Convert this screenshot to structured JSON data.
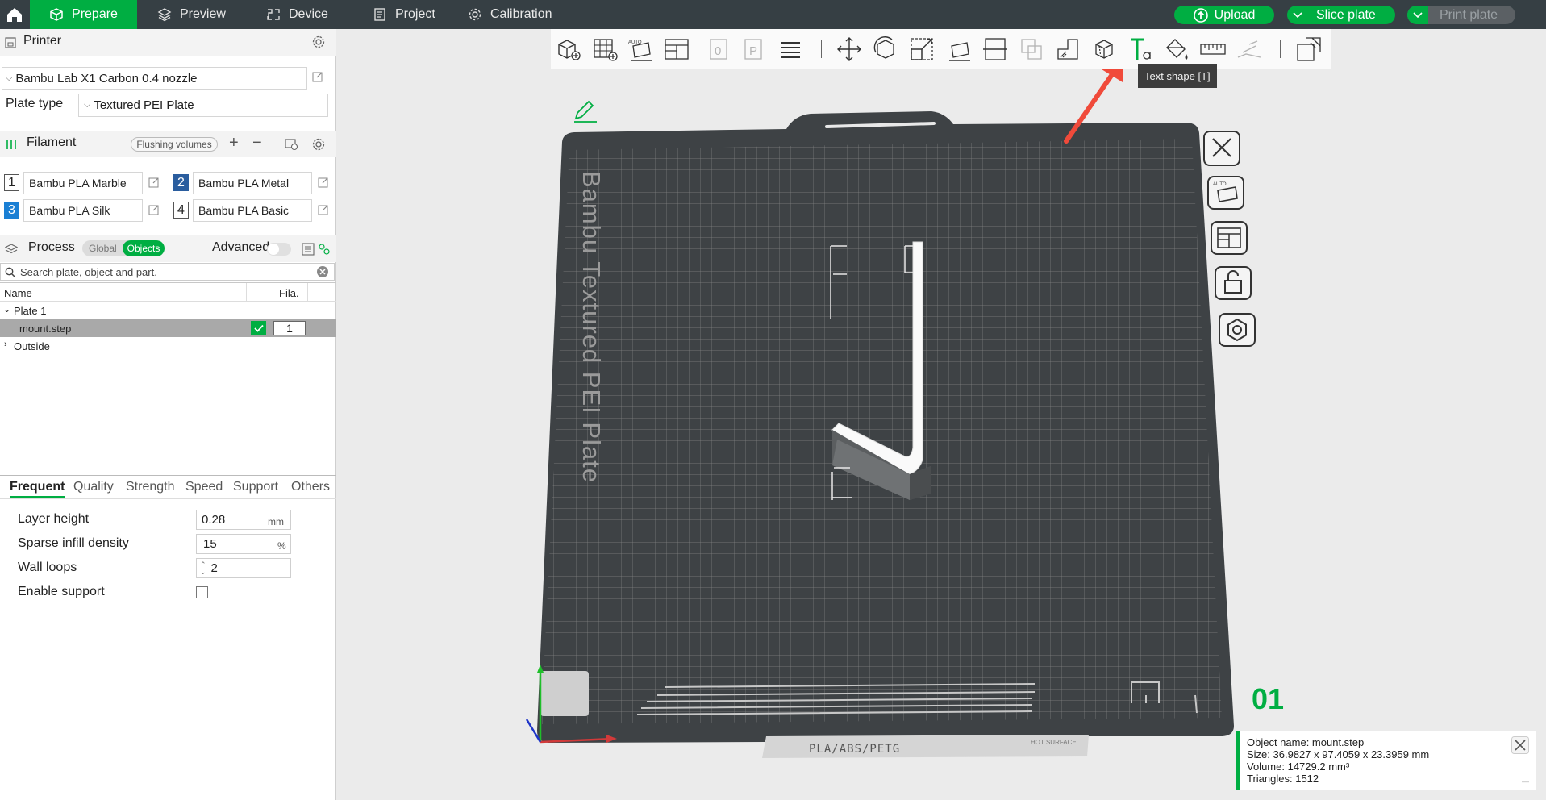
{
  "topbar": {
    "tabs": [
      {
        "label": "Prepare",
        "icon": "cube-icon"
      },
      {
        "label": "Preview",
        "icon": "layers-icon"
      },
      {
        "label": "Device",
        "icon": "device-icon"
      },
      {
        "label": "Project",
        "icon": "project-icon"
      },
      {
        "label": "Calibration",
        "icon": "calibration-icon"
      }
    ],
    "upload_label": "Upload",
    "slice_label": "Slice plate",
    "print_label": "Print plate",
    "accent": "#00ae42"
  },
  "printer": {
    "section_title": "Printer",
    "name": "Bambu Lab X1 Carbon 0.4 nozzle",
    "plate_type_label": "Plate type",
    "plate_type_value": "Textured PEI Plate"
  },
  "filament": {
    "section_title": "Filament",
    "flushing_label": "Flushing volumes",
    "items": [
      {
        "num": "1",
        "name": "Bambu PLA Marble",
        "color": "#ffffff"
      },
      {
        "num": "2",
        "name": "Bambu PLA Metal",
        "color": "#2a5d9e"
      },
      {
        "num": "3",
        "name": "Bambu PLA Silk",
        "color": "#1a7fd4"
      },
      {
        "num": "4",
        "name": "Bambu PLA Basic",
        "color": "#ffffff"
      }
    ]
  },
  "process": {
    "section_title": "Process",
    "global_label": "Global",
    "objects_label": "Objects",
    "advanced_label": "Advanced",
    "search_placeholder": "Search plate, object and part."
  },
  "object_list": {
    "col_name": "Name",
    "col_fila": "Fila.",
    "plate_label": "Plate 1",
    "object_name": "mount.step",
    "object_fila": "1",
    "outside_label": "Outside"
  },
  "param_tabs": [
    "Frequent",
    "Quality",
    "Strength",
    "Speed",
    "Support",
    "Others"
  ],
  "params": {
    "layer_height_label": "Layer height",
    "layer_height_value": "0.28",
    "layer_height_unit": "mm",
    "sparse_infill_label": "Sparse infill density",
    "sparse_infill_value": "15",
    "sparse_infill_unit": "%",
    "wall_loops_label": "Wall loops",
    "wall_loops_value": "2",
    "enable_support_label": "Enable support"
  },
  "viewport": {
    "tooltip": "Text shape [T]",
    "plate_text": "Bambu Textured PEI Plate",
    "plate_bottom_text": "PLA/ABS/PETG",
    "hot_surface_text": "HOT SURFACE",
    "plate_number": "01"
  },
  "object_info": {
    "name_line": "Object name: mount.step",
    "size_line": "Size: 36.9827 x 97.4059 x 23.3959 mm",
    "volume_line": "Volume: 14729.2 mm³",
    "triangles_line": "Triangles: 1512"
  }
}
